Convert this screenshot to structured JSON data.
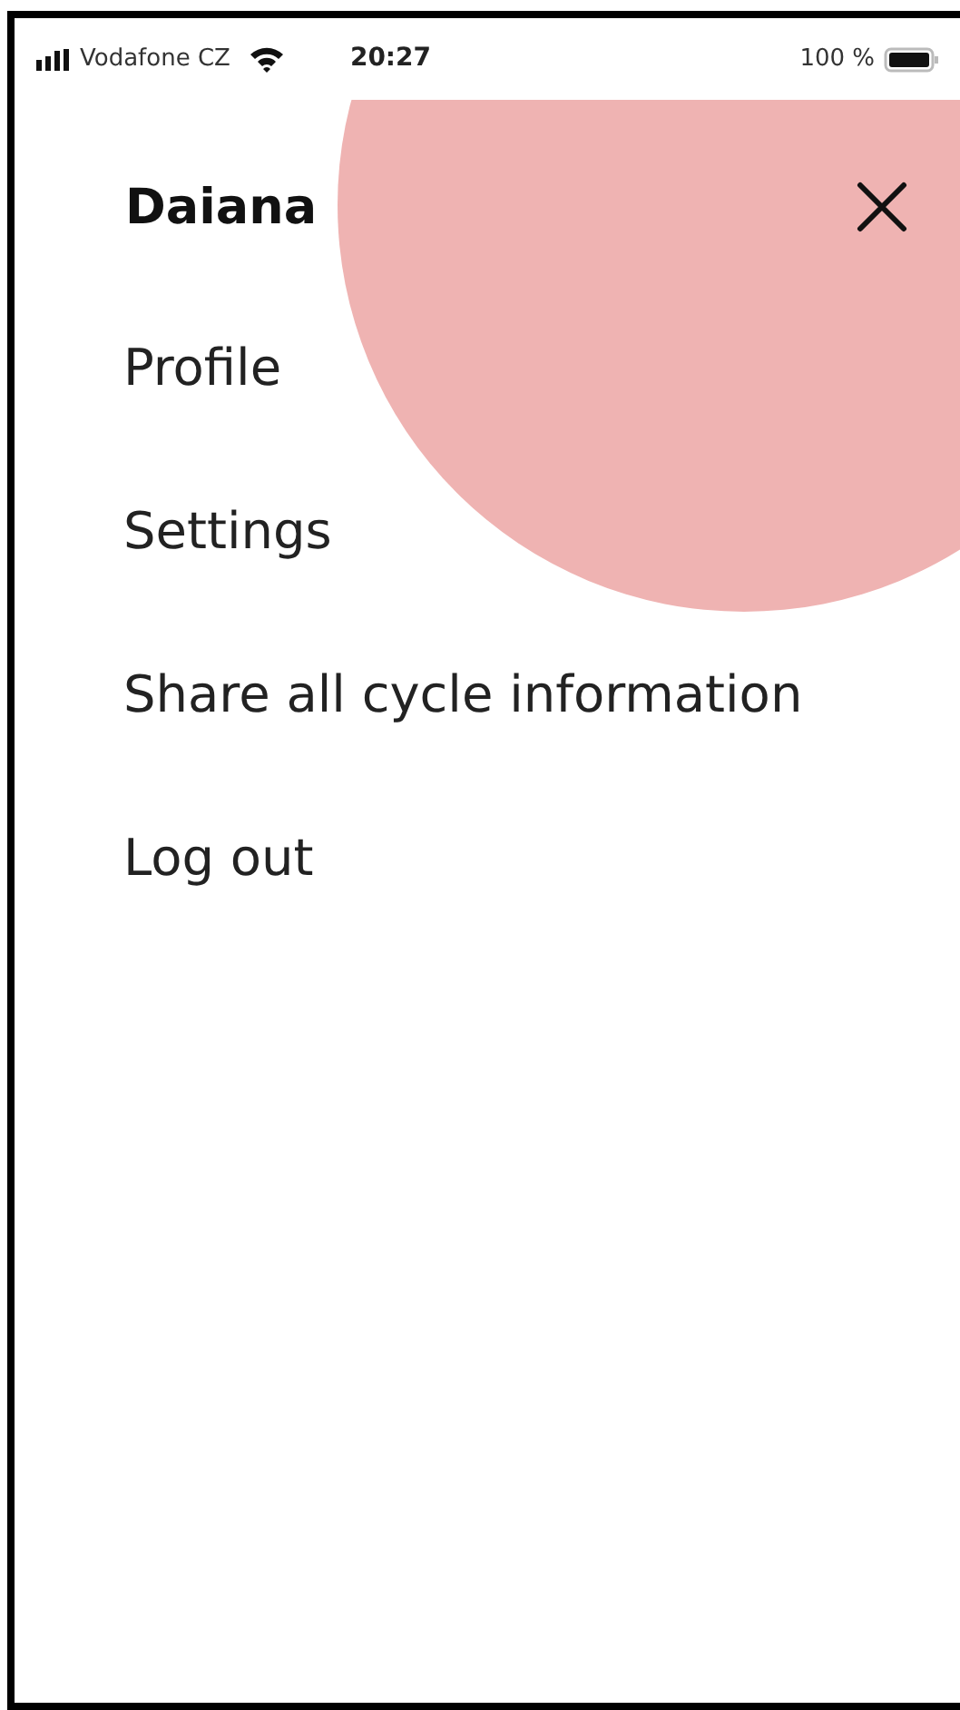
{
  "status_bar": {
    "carrier": "Vodafone CZ",
    "time": "20:27",
    "battery": "100 %"
  },
  "header": {
    "name": "Daiana"
  },
  "menu": [
    {
      "label": "Profile"
    },
    {
      "label": "Settings"
    },
    {
      "label": "Share all cycle information"
    },
    {
      "label": "Log out"
    }
  ]
}
